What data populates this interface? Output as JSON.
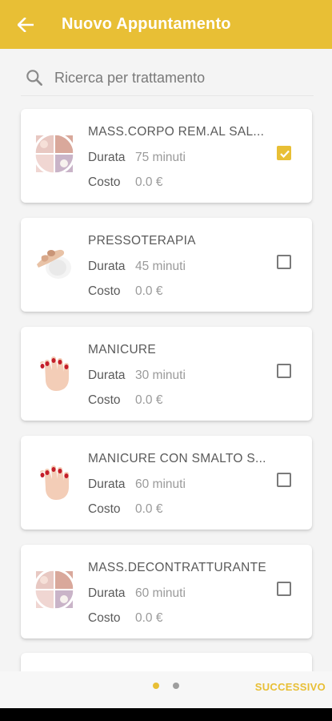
{
  "header": {
    "title": "Nuovo Appuntamento",
    "back_icon": "arrow-left-icon"
  },
  "search": {
    "placeholder": "Ricerca per trattamento",
    "value": ""
  },
  "labels": {
    "duration": "Durata",
    "cost": "Costo"
  },
  "treatments": [
    {
      "name": "MASS.CORPO REM.AL SAL...",
      "duration": "75 minuti",
      "cost": "0.0 €",
      "checked": true,
      "image": "massage-collage-image"
    },
    {
      "name": "PRESSOTERAPIA",
      "duration": "45 minuti",
      "cost": "0.0 €",
      "checked": false,
      "image": "pressotherapy-image"
    },
    {
      "name": "MANICURE",
      "duration": "30 minuti",
      "cost": "0.0 €",
      "checked": false,
      "image": "red-nails-image"
    },
    {
      "name": "MANICURE CON SMALTO S...",
      "duration": "60 minuti",
      "cost": "0.0 €",
      "checked": false,
      "image": "red-nails-image"
    },
    {
      "name": "MASS.DECONTRATTURANTE",
      "duration": "60 minuti",
      "cost": "0.0 €",
      "checked": false,
      "image": "massage-collage-image"
    }
  ],
  "footer": {
    "next_label": "SUCCESSIVO",
    "page_count": 2,
    "current_page": 1
  },
  "colors": {
    "accent": "#e8bf35",
    "background": "#f4f4f4"
  }
}
